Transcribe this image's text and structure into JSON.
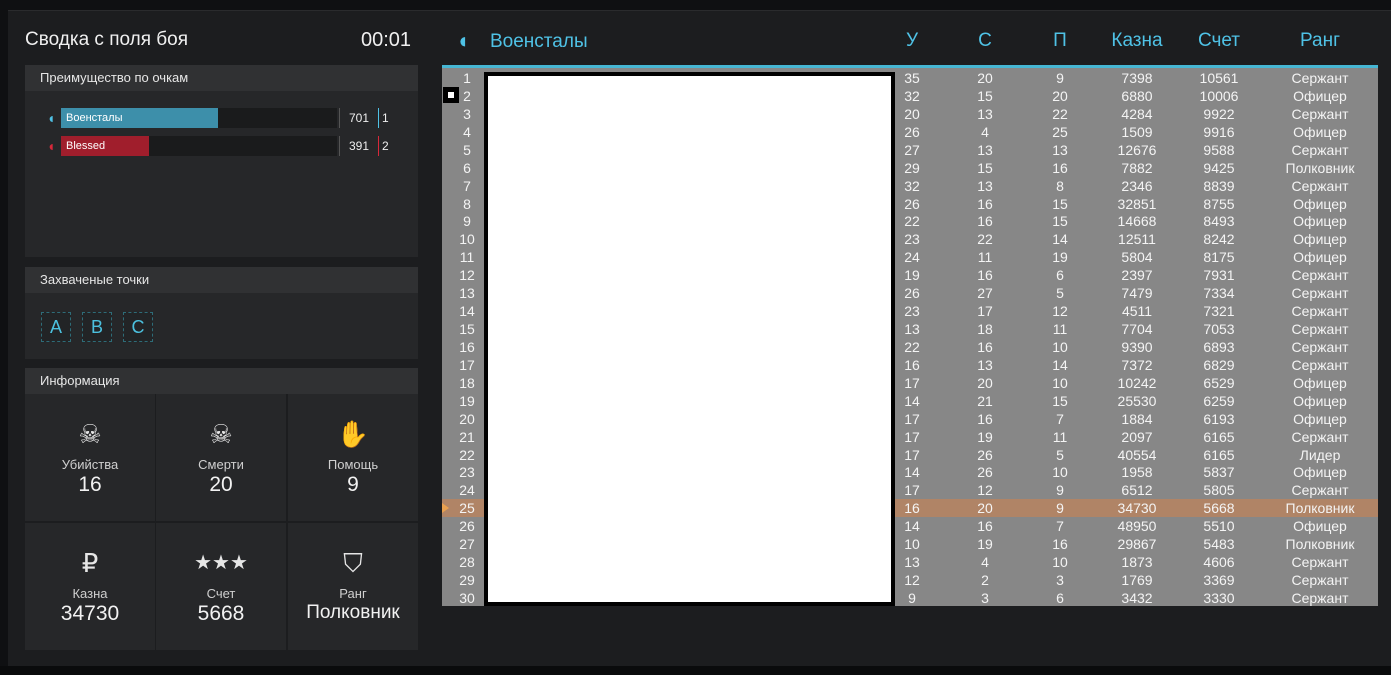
{
  "summary": {
    "title": "Сводка с поля боя",
    "timer": "00:01"
  },
  "advantage": {
    "header": "Преимущество по очкам",
    "teams": [
      {
        "name": "Военсталы",
        "score": "701",
        "place": "1",
        "fill": 0.57,
        "color": "#3d8faa",
        "icon": "eagle-icon"
      },
      {
        "name": "Blessed",
        "score": "391",
        "place": "2",
        "fill": 0.32,
        "color": "#a01e2c",
        "icon": "eagle-icon"
      }
    ]
  },
  "points": {
    "header": "Захваченые точки",
    "items": [
      "A",
      "B",
      "C"
    ]
  },
  "info": {
    "header": "Информация",
    "cells": [
      {
        "icon": "skull-icon",
        "glyph": "☠",
        "label": "Убийства",
        "value": "16"
      },
      {
        "icon": "skull-crossbones-icon",
        "glyph": "☠",
        "label": "Смерти",
        "value": "20"
      },
      {
        "icon": "handshake-icon",
        "glyph": "✋",
        "label": "Помощь",
        "value": "9"
      },
      {
        "icon": "ruble-icon",
        "glyph": "₽",
        "label": "Казна",
        "value": "34730"
      },
      {
        "icon": "stars-icon",
        "glyph": "★★★",
        "label": "Счет",
        "value": "5668"
      },
      {
        "icon": "rank-badge-icon",
        "glyph": "⛉",
        "label": "Ранг",
        "value": "Полковник"
      }
    ]
  },
  "scoreboard": {
    "team": "Военсталы",
    "columns": {
      "kills": "У",
      "deaths": "С",
      "assists": "П",
      "treasury": "Казна",
      "score": "Счет",
      "rank": "Ранг"
    },
    "highlight_index": 24,
    "rows": [
      [
        "1",
        "35",
        "20",
        "9",
        "7398",
        "10561",
        "Сержант"
      ],
      [
        "2",
        "32",
        "15",
        "20",
        "6880",
        "10006",
        "Офицер"
      ],
      [
        "3",
        "20",
        "13",
        "22",
        "4284",
        "9922",
        "Сержант"
      ],
      [
        "4",
        "26",
        "4",
        "25",
        "1509",
        "9916",
        "Офицер"
      ],
      [
        "5",
        "27",
        "13",
        "13",
        "12676",
        "9588",
        "Сержант"
      ],
      [
        "6",
        "29",
        "15",
        "16",
        "7882",
        "9425",
        "Полковник"
      ],
      [
        "7",
        "32",
        "13",
        "8",
        "2346",
        "8839",
        "Сержант"
      ],
      [
        "8",
        "26",
        "16",
        "15",
        "32851",
        "8755",
        "Офицер"
      ],
      [
        "9",
        "22",
        "16",
        "15",
        "14668",
        "8493",
        "Офицер"
      ],
      [
        "10",
        "23",
        "22",
        "14",
        "12511",
        "8242",
        "Офицер"
      ],
      [
        "11",
        "24",
        "11",
        "19",
        "5804",
        "8175",
        "Офицер"
      ],
      [
        "12",
        "19",
        "16",
        "6",
        "2397",
        "7931",
        "Сержант"
      ],
      [
        "13",
        "26",
        "27",
        "5",
        "7479",
        "7334",
        "Сержант"
      ],
      [
        "14",
        "23",
        "17",
        "12",
        "4511",
        "7321",
        "Сержант"
      ],
      [
        "15",
        "13",
        "18",
        "11",
        "7704",
        "7053",
        "Сержант"
      ],
      [
        "16",
        "22",
        "16",
        "10",
        "9390",
        "6893",
        "Сержант"
      ],
      [
        "17",
        "16",
        "13",
        "14",
        "7372",
        "6829",
        "Сержант"
      ],
      [
        "18",
        "17",
        "20",
        "10",
        "10242",
        "6529",
        "Офицер"
      ],
      [
        "19",
        "14",
        "21",
        "15",
        "25530",
        "6259",
        "Офицер"
      ],
      [
        "20",
        "17",
        "16",
        "7",
        "1884",
        "6193",
        "Офицер"
      ],
      [
        "21",
        "17",
        "19",
        "11",
        "2097",
        "6165",
        "Сержант"
      ],
      [
        "22",
        "17",
        "26",
        "5",
        "40554",
        "6165",
        "Лидер"
      ],
      [
        "23",
        "14",
        "26",
        "10",
        "1958",
        "5837",
        "Офицер"
      ],
      [
        "24",
        "17",
        "12",
        "9",
        "6512",
        "5805",
        "Сержант"
      ],
      [
        "25",
        "16",
        "20",
        "9",
        "34730",
        "5668",
        "Полковник"
      ],
      [
        "26",
        "14",
        "16",
        "7",
        "48950",
        "5510",
        "Офицер"
      ],
      [
        "27",
        "10",
        "19",
        "16",
        "29867",
        "5483",
        "Полковник"
      ],
      [
        "28",
        "13",
        "4",
        "10",
        "1873",
        "4606",
        "Сержант"
      ],
      [
        "29",
        "12",
        "2",
        "3",
        "1769",
        "3369",
        "Сержант"
      ],
      [
        "30",
        "9",
        "3",
        "6",
        "3432",
        "3330",
        "Сержант"
      ]
    ]
  }
}
